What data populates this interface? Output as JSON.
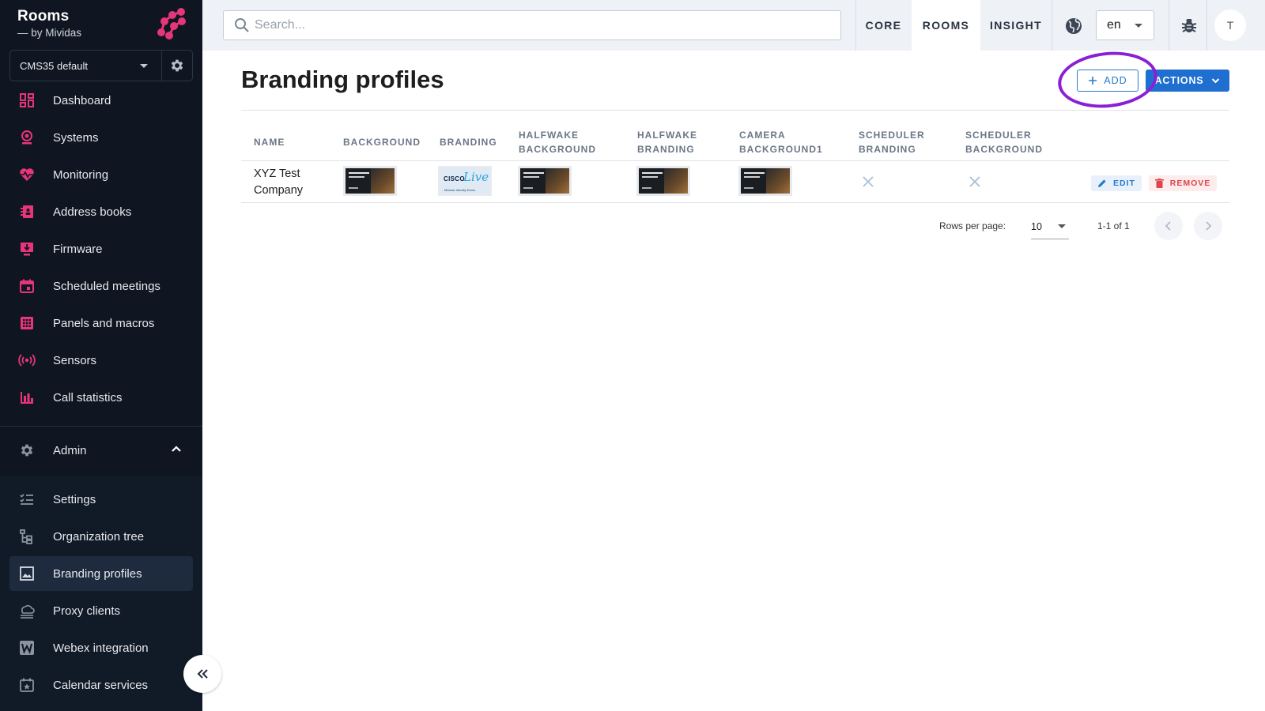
{
  "brand": {
    "title": "Rooms",
    "subtitle": "— by Mividas"
  },
  "tenant": {
    "label": "CMS35 default"
  },
  "nav": {
    "items": [
      {
        "label": "Dashboard"
      },
      {
        "label": "Systems"
      },
      {
        "label": "Monitoring"
      },
      {
        "label": "Address books"
      },
      {
        "label": "Firmware"
      },
      {
        "label": "Scheduled meetings"
      },
      {
        "label": "Panels and macros"
      },
      {
        "label": "Sensors"
      },
      {
        "label": "Call statistics"
      }
    ],
    "admin_label": "Admin",
    "admin_items": [
      {
        "label": "Settings"
      },
      {
        "label": "Organization tree"
      },
      {
        "label": "Branding profiles"
      },
      {
        "label": "Proxy clients"
      },
      {
        "label": "Webex integration"
      },
      {
        "label": "Calendar services"
      }
    ]
  },
  "topbar": {
    "search_placeholder": "Search...",
    "tabs": [
      {
        "label": "CORE"
      },
      {
        "label": "ROOMS"
      },
      {
        "label": "INSIGHT"
      }
    ],
    "language": "en",
    "avatar_initial": "T"
  },
  "page": {
    "title": "Branding profiles",
    "add_label": "ADD",
    "actions_label": "ACTIONS"
  },
  "table": {
    "columns": [
      {
        "l1": "NAME",
        "l2": ""
      },
      {
        "l1": "BACKGROUND",
        "l2": ""
      },
      {
        "l1": "BRANDING",
        "l2": ""
      },
      {
        "l1": "HALFWAKE",
        "l2": "BACKGROUND"
      },
      {
        "l1": "HALFWAKE",
        "l2": "BRANDING"
      },
      {
        "l1": "CAMERA",
        "l2": "BACKGROUND1"
      },
      {
        "l1": "SCHEDULER",
        "l2": "BRANDING"
      },
      {
        "l1": "SCHEDULER",
        "l2": "BACKGROUND"
      }
    ],
    "rows": [
      {
        "name_line1": "XYZ Test",
        "name_line2": "Company",
        "edit_label": "EDIT",
        "remove_label": "REMOVE",
        "branding_thumb": {
          "brand": "CISCO",
          "live": "Live!",
          "caption": "Mividas Identity Demo"
        }
      }
    ]
  },
  "pagination": {
    "rows_per_page_label": "Rows per page:",
    "rows_per_page_value": "10",
    "range_label": "1-1 of 1"
  },
  "colors": {
    "sidebar_bg": "#0f1621",
    "accent_pink": "#e8357a",
    "primary_blue": "#1f6fd1",
    "highlight_ring": "#8a1fd6",
    "danger_red": "#e0434b"
  }
}
